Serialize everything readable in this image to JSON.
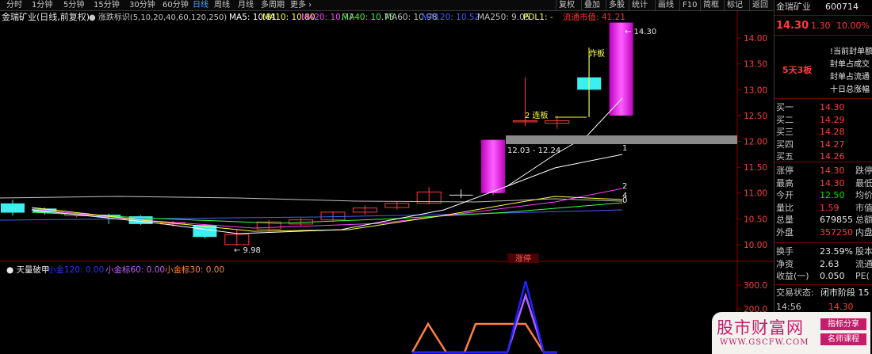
{
  "toolbar": {
    "periods": [
      "分时",
      "1分钟",
      "5分钟",
      "15分钟",
      "30分钟",
      "60分钟",
      "日线",
      "周线",
      "月线",
      "多周期",
      "更多 ›"
    ],
    "active_index": 6,
    "right_items": [
      "复权",
      "叠加",
      "多股",
      "统计",
      "画线",
      "F10",
      "简框",
      "标记",
      "返回"
    ]
  },
  "legend": {
    "stock": "金瑞矿业(日线,前复权)",
    "indicator": "涨跌标识(5,10,20,40,60,120,250)",
    "ma": [
      {
        "label": "MA5: 10.81",
        "color": "#ffffff"
      },
      {
        "label": "MA10: 10.80",
        "color": "#ffff40"
      },
      {
        "label": "MA20: 10.77",
        "color": "#ff40ff"
      },
      {
        "label": "MA40: 10.75",
        "color": "#40ff40"
      },
      {
        "label": "MA60: 10.98",
        "color": "#c0c0c0"
      },
      {
        "label": "MA120: 10.52",
        "color": "#4060ff"
      },
      {
        "label": "MA250: 9.05",
        "color": "#c0c0c0"
      },
      {
        "label": "PDL1: -",
        "color": "#ffff40"
      },
      {
        "label": "流通市值: 41.21",
        "color": "#ff3030"
      }
    ]
  },
  "lower_legend": {
    "title": "天量破甲",
    "items": [
      {
        "label": "小金120: 0.00",
        "color": "#3030ff"
      },
      {
        "label": "小金标60: 0.00",
        "color": "#c060ff"
      },
      {
        "label": "小金标30: 0.00",
        "color": "#ff8040"
      }
    ]
  },
  "chart_data": {
    "type": "candlestick",
    "ylim": [
      9.8,
      14.4
    ],
    "y_ticks": [
      "14.00",
      "13.50",
      "13.00",
      "12.50",
      "12.00",
      "11.50",
      "11.00",
      "10.50",
      "10.00"
    ],
    "candles": [
      {
        "o": 10.8,
        "h": 10.87,
        "l": 10.56,
        "c": 10.62,
        "color": "cyan"
      },
      {
        "o": 10.7,
        "h": 10.72,
        "l": 10.58,
        "c": 10.62,
        "color": "cyan"
      },
      {
        "o": 10.6,
        "h": 10.62,
        "l": 10.53,
        "c": 10.56,
        "color": "red"
      },
      {
        "o": 10.58,
        "h": 10.6,
        "l": 10.4,
        "c": 10.53,
        "color": "cyan"
      },
      {
        "o": 10.55,
        "h": 10.57,
        "l": 10.38,
        "c": 10.4,
        "color": "cyan"
      },
      {
        "o": 10.43,
        "h": 10.46,
        "l": 10.35,
        "c": 10.4,
        "color": "red"
      },
      {
        "o": 10.38,
        "h": 10.4,
        "l": 10.12,
        "c": 10.15,
        "color": "cyan"
      },
      {
        "o": 10.0,
        "h": 10.3,
        "l": 9.98,
        "c": 10.2,
        "color": "red"
      },
      {
        "o": 10.3,
        "h": 10.48,
        "l": 10.25,
        "c": 10.44,
        "color": "red"
      },
      {
        "o": 10.4,
        "h": 10.52,
        "l": 10.37,
        "c": 10.48,
        "color": "red"
      },
      {
        "o": 10.48,
        "h": 10.65,
        "l": 10.44,
        "c": 10.63,
        "color": "red"
      },
      {
        "o": 10.63,
        "h": 10.76,
        "l": 10.58,
        "c": 10.71,
        "color": "red"
      },
      {
        "o": 10.72,
        "h": 10.84,
        "l": 10.68,
        "c": 10.8,
        "color": "red"
      },
      {
        "o": 10.8,
        "h": 11.12,
        "l": 10.78,
        "c": 11.02,
        "color": "red"
      },
      {
        "o": 10.95,
        "h": 11.07,
        "l": 10.9,
        "c": 10.96,
        "color": "white"
      },
      {
        "o": 11.0,
        "h": 12.03,
        "l": 10.95,
        "c": 12.03,
        "color": "magenta"
      },
      {
        "o": 12.4,
        "h": 13.24,
        "l": 12.3,
        "c": 12.4,
        "color": "red"
      },
      {
        "o": 12.35,
        "h": 12.5,
        "l": 12.24,
        "c": 12.4,
        "color": "red"
      },
      {
        "o": 13.0,
        "h": 13.66,
        "l": 12.48,
        "c": 13.24,
        "color": "cyan"
      },
      {
        "o": 12.5,
        "h": 14.3,
        "l": 12.5,
        "c": 14.3,
        "color": "magenta"
      }
    ],
    "annotations": {
      "low_label": "9.98",
      "high_label": "14.30",
      "gap_label": "12.03 - 12.24",
      "lianban_label": "2 连板",
      "zhaban_label": "炸板",
      "line_labels": [
        "1",
        "2",
        "4",
        "0"
      ],
      "zhangting_tag": "涨停"
    },
    "lower": {
      "ticks": [
        "300.0",
        "200.0"
      ],
      "x": [
        520,
        540,
        563,
        586,
        600,
        623,
        640,
        663,
        686,
        703
      ],
      "blue": [
        0,
        0,
        0,
        0,
        0,
        0,
        0,
        300,
        0,
        0
      ],
      "purple": [
        0,
        0,
        0,
        0,
        0,
        0,
        0,
        240,
        0,
        0
      ],
      "orange": [
        0,
        120,
        0,
        0,
        120,
        120,
        120,
        120,
        0,
        0
      ]
    }
  },
  "panel": {
    "name": "金瑞矿业",
    "code": "600714",
    "price": "14.30",
    "change": "1.30",
    "pct": "10.00%",
    "tag": "5天3板",
    "notes": [
      "!当前封单额",
      "封单占成交",
      "封单占流通",
      "十日总涨幅"
    ],
    "bids": [
      {
        "label": "买一",
        "value": "14.30"
      },
      {
        "label": "买二",
        "value": "14.29"
      },
      {
        "label": "买三",
        "value": "14.28"
      },
      {
        "label": "买四",
        "value": "14.27"
      },
      {
        "label": "买五",
        "value": "14.26"
      }
    ],
    "stats": [
      {
        "label": "涨停",
        "value": "14.30",
        "extra": "跌停",
        "cls": "red"
      },
      {
        "label": "最高",
        "value": "14.30",
        "extra": "最低",
        "cls": "red"
      },
      {
        "label": "今开",
        "value": "12.50",
        "extra": "均价",
        "cls": "green"
      },
      {
        "label": "量比",
        "value": "1.59",
        "extra": "市值",
        "cls": "red"
      },
      {
        "label": "总量",
        "value": "679855",
        "extra": "总额",
        "cls": "white"
      },
      {
        "label": "外盘",
        "value": "357250",
        "extra": "内盘",
        "cls": "red"
      }
    ],
    "stats2": [
      {
        "label": "换手",
        "value": "23.59%",
        "extra": "股本",
        "cls": "white"
      },
      {
        "label": "净资",
        "value": "2.63",
        "extra": "流通",
        "cls": "white"
      },
      {
        "label": "收益(一)",
        "value": "0.050",
        "extra": "PE(",
        "cls": "white"
      }
    ],
    "status_label": "交易状态:",
    "status_value": "闭市阶段 15",
    "last_time": "14:56",
    "last_price": "14.30"
  },
  "watermark": {
    "title": "股市财富网",
    "url": "WWW.GSCFW.COM",
    "tag1": "指标分享",
    "tag2": "名师课程"
  }
}
